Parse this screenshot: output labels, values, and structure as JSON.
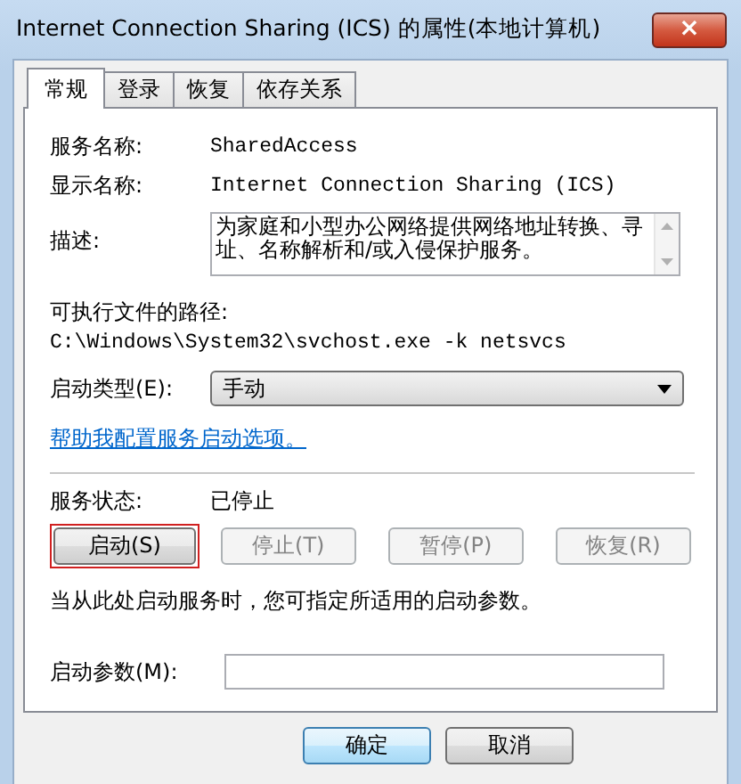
{
  "window": {
    "title": "Internet Connection Sharing (ICS) 的属性(本地计算机)",
    "close": "×"
  },
  "tabs": [
    {
      "label": "常规",
      "selected": true
    },
    {
      "label": "登录",
      "selected": false
    },
    {
      "label": "恢复",
      "selected": false
    },
    {
      "label": "依存关系",
      "selected": false
    }
  ],
  "fields": [
    {
      "label": "服务名称:",
      "value": "SharedAccess"
    },
    {
      "label": "显示名称:",
      "value": "Internet Connection Sharing (ICS)"
    }
  ],
  "description": {
    "label": "描述:",
    "value": "为家庭和小型办公网络提供网络地址转换、寻址、名称解析和/或入侵保护服务。"
  },
  "path": {
    "label": "可执行文件的路径:",
    "value": "C:\\Windows\\System32\\svchost.exe -k netsvcs"
  },
  "startup_type": {
    "label": "启动类型(E):",
    "value": "手动"
  },
  "help_link": "帮助我配置服务启动选项。",
  "status": {
    "label": "服务状态:",
    "value": "已停止"
  },
  "service_buttons": [
    {
      "label": "启动(S)",
      "disabled": false,
      "highlighted": true
    },
    {
      "label": "停止(T)",
      "disabled": true,
      "highlighted": false
    },
    {
      "label": "暂停(P)",
      "disabled": true,
      "highlighted": false
    },
    {
      "label": "恢复(R)",
      "disabled": true,
      "highlighted": false
    }
  ],
  "hint": "当从此处启动服务时，您可指定所适用的启动参数。",
  "start_params": {
    "label": "启动参数(M):"
  },
  "dialog_buttons": [
    {
      "label": "确定",
      "default": true
    },
    {
      "label": "取消",
      "default": false
    }
  ]
}
